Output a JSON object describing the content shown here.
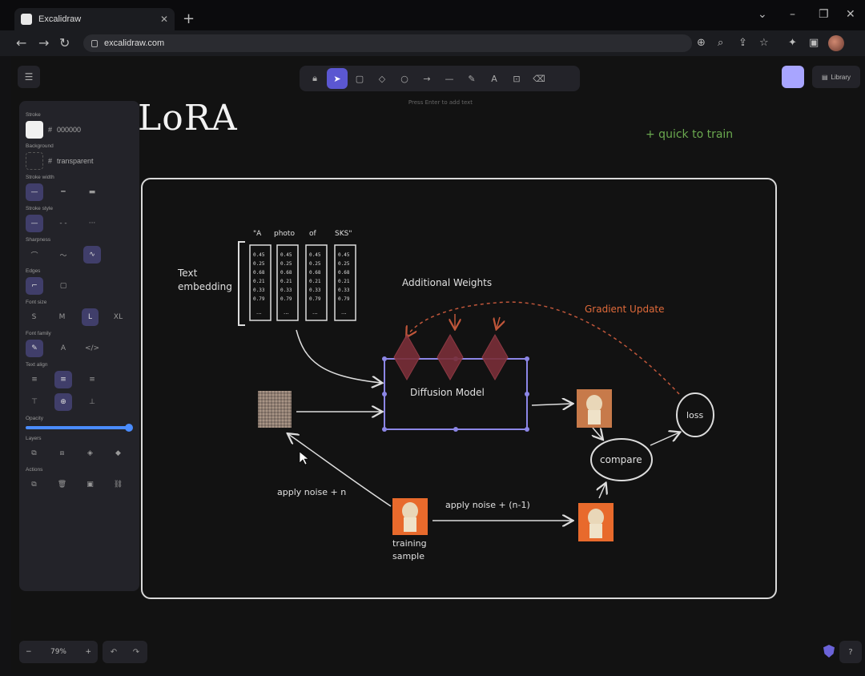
{
  "browser": {
    "tab_title": "Excalidraw",
    "tab_close": "✕",
    "new_tab": "+",
    "url": "excalidraw.com",
    "controls": {
      "chevron": "⌄",
      "minimize": "–",
      "restore": "❐",
      "close": "✕"
    }
  },
  "toolbar": {
    "tools": [
      "lock",
      "selection",
      "rectangle",
      "diamond",
      "ellipse",
      "arrow",
      "line",
      "draw",
      "text",
      "image",
      "eraser"
    ],
    "active_tool": "selection",
    "hint": "Press Enter to add text",
    "library_label": "Library"
  },
  "panel": {
    "stroke_label": "Stroke",
    "stroke_hex": "000000",
    "background_label": "Background",
    "background_value": "transparent",
    "stroke_width_label": "Stroke width",
    "stroke_style_label": "Stroke style",
    "sharpness_label": "Sharpness",
    "edges_label": "Edges",
    "font_size_label": "Font size",
    "font_sizes": [
      "S",
      "M",
      "L",
      "XL"
    ],
    "font_size_selected": "L",
    "font_family_label": "Font family",
    "text_align_label": "Text align",
    "opacity_label": "Opacity",
    "opacity": 1.0,
    "layers_label": "Layers",
    "actions_label": "Actions"
  },
  "zoom": {
    "minus": "−",
    "level": "79%",
    "plus": "+"
  },
  "canvas": {
    "title": "LoRA",
    "quick_note": "+ quick to train",
    "tokens": [
      "\"A",
      "photo",
      "of",
      "SKS\""
    ],
    "token_values": [
      "0.45",
      "0.25",
      "0.68",
      "0.21",
      "0.33",
      "0.79"
    ],
    "token_ellipsis": "...",
    "text_embedding_line1": "Text",
    "text_embedding_line2": "embedding",
    "additional_weights": "Additional Weights",
    "gradient_update": "Gradient Update",
    "diffusion_model": "Diffusion Model",
    "loss": "loss",
    "compare": "compare",
    "apply_noise_n": "apply noise + n",
    "apply_noise_n1": "apply noise + (n-1)",
    "training_sample_line1": "training",
    "training_sample_line2": "sample"
  },
  "colors": {
    "accent": "#5b57d1",
    "quick_note": "#6aa84f",
    "gradient": "#e06a3a",
    "weights": "#7a2e38",
    "dog_bg": "#e86a2c"
  }
}
